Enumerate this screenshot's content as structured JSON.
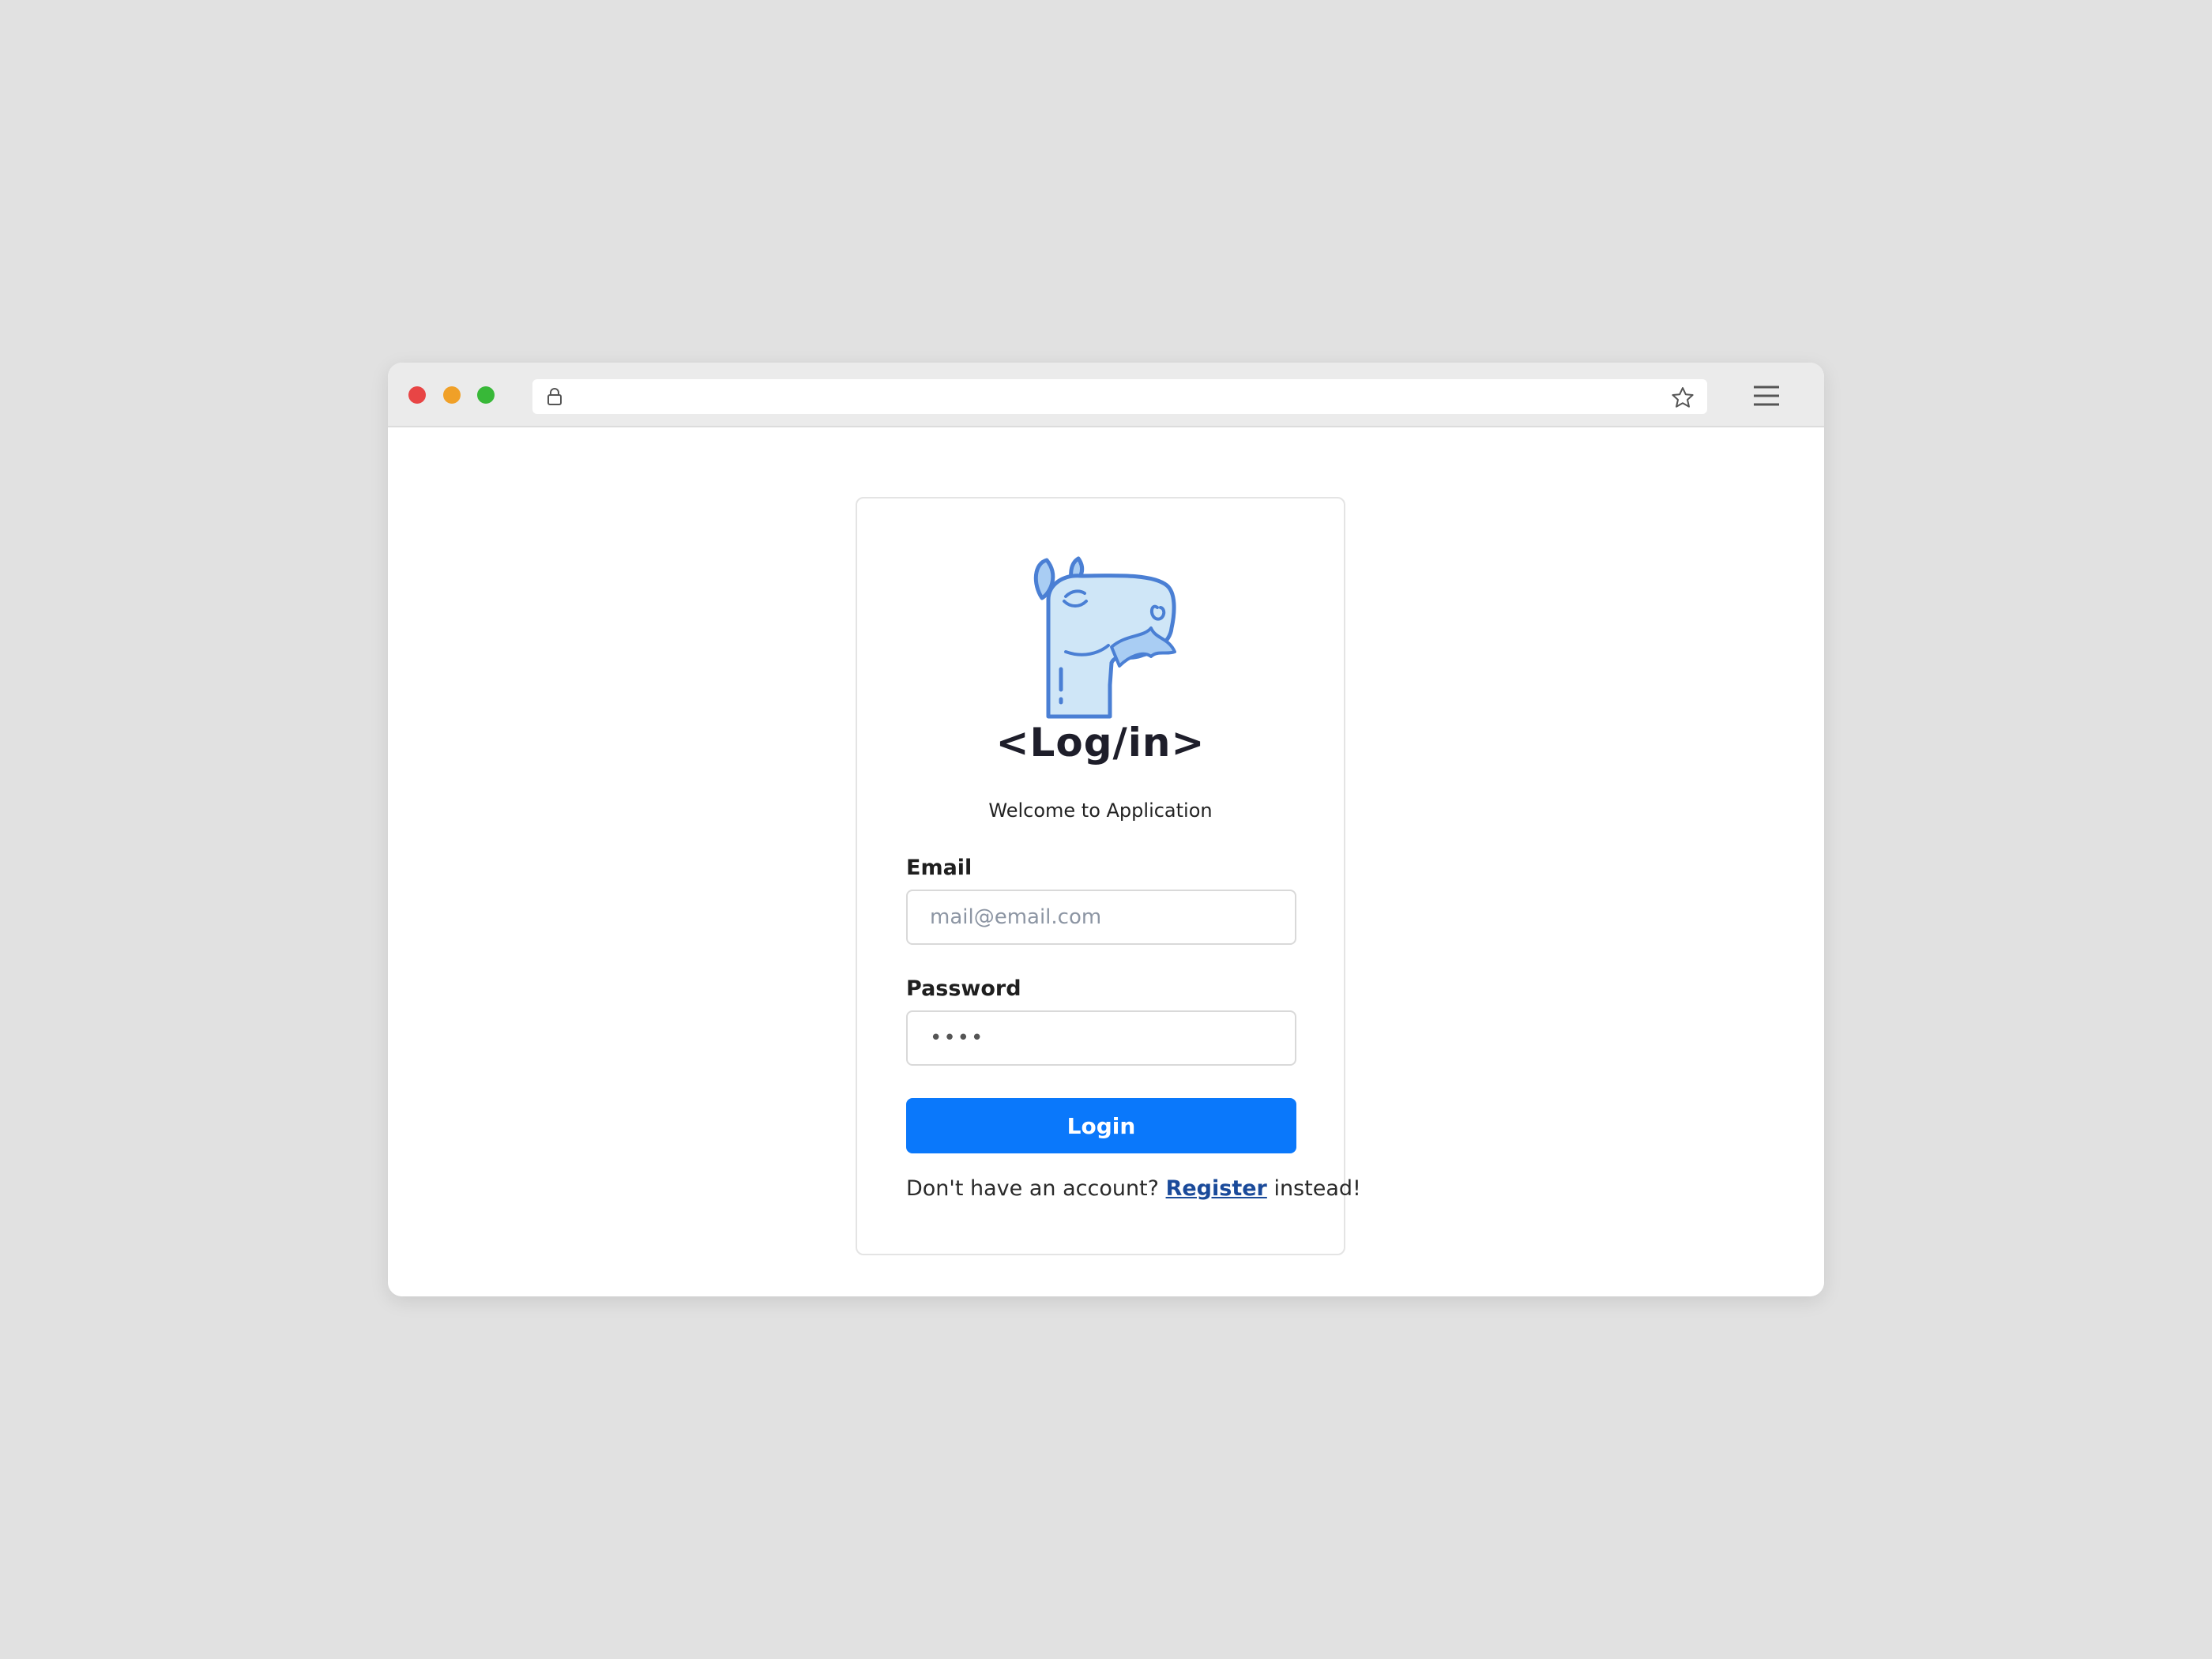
{
  "browser": {
    "address": ""
  },
  "login": {
    "title": "<Log/in>",
    "subtitle": "Welcome to Application",
    "email_label": "Email",
    "email_placeholder": "mail@email.com",
    "email_value": "",
    "password_label": "Password",
    "password_value": "****",
    "submit_label": "Login",
    "register_prefix": "Don't have an account? ",
    "register_link": "Register",
    "register_suffix": " instead!"
  },
  "icons": {
    "lock": "lock-icon",
    "star": "star-icon",
    "menu": "hamburger-menu-icon",
    "logo": "camel-logo"
  },
  "colors": {
    "primary_button": "#0a78fb",
    "link": "#1a4a9a",
    "logo_stroke": "#4a7fd4",
    "logo_fill": "#cfe6f7"
  }
}
